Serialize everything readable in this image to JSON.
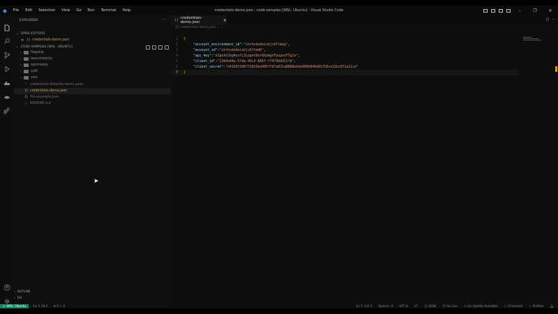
{
  "titlebar": {
    "menu": [
      "File",
      "Edit",
      "Selection",
      "View",
      "Go",
      "Run",
      "Terminal",
      "Help"
    ],
    "title": "credentials-demo.json - code-samples [WSL: Ubuntu] - Visual Studio Code",
    "minimize": "–",
    "maximize": "❐",
    "close": "✕"
  },
  "sidebar": {
    "header": "EXPLORER",
    "more": "···",
    "open_editors": {
      "label": "OPEN EDITORS",
      "items": [
        {
          "name": "credentials-demo.json",
          "icon": "{}"
        }
      ]
    },
    "workspace": {
      "label": "CODE-SAMPLES [WSL: UBUNTU]",
      "folders": [
        "flagship",
        "launchdarkly",
        "optimizely",
        "split",
        "vwo"
      ],
      "files": [
        {
          "name": "credentials-dittocity-demo.yaml",
          "icon": "!"
        },
        {
          "name": "credentials-demo.json",
          "icon": "{}"
        },
        {
          "name": "file-example.json",
          "icon": "{}"
        },
        {
          "name": "README.md",
          "icon": "ⓘ"
        }
      ]
    },
    "outline": "OUTLINE",
    "git": "GO"
  },
  "editor": {
    "tab_label": "credentials-demo.json",
    "tab_close": "✕",
    "breadcrumb": [
      "credentials-demo.json",
      "..."
    ],
    "lines": [
      {
        "n": "1",
        "open": "{"
      },
      {
        "n": "2",
        "key": "\"account_environment_id\"",
        "value": "\"chrhsdodeiuhjc6flmeg\""
      },
      {
        "n": "3",
        "key": "\"account_id\"",
        "value": "\"chrhsdodeiuhjc6flmd0\""
      },
      {
        "n": "4",
        "key": "\"api_key\"",
        "value": "\"dJgoXdJbgRsofL3LpgetDor0XpmgvFpupovFTgJo\""
      },
      {
        "n": "5",
        "key": "\"client_id\"",
        "value": "\"23b0a44e-5f4a-40c3-866f-f74749d251fb\""
      },
      {
        "n": "6",
        "key": "\"client_secret\"",
        "value": "\"d4169f206772833bd485ffd7a831a8888eb4a900b046d61f50ce32bc872a11ce\""
      },
      {
        "n": "7",
        "close": "}"
      }
    ]
  },
  "statusbar": {
    "remote": "WSL: Ubuntu",
    "branch": "Go 1.18.4",
    "problems": "⊗ 0 ⚠ 0",
    "position": "Ln 7, Col 2",
    "spaces": "Spaces: 4",
    "encoding": "UTF-8",
    "eol": "LF",
    "language": "{} JSON",
    "golive": "⦿ Go Live",
    "update": "⚠ Go Update Available",
    "chronicler": "✓ Chronicler",
    "prettier": "✓ Prettier"
  },
  "colors": {
    "key": "#9cdcfe",
    "string": "#ce9178",
    "brace": "#d7ba04",
    "remote_badge": "#16825d"
  }
}
